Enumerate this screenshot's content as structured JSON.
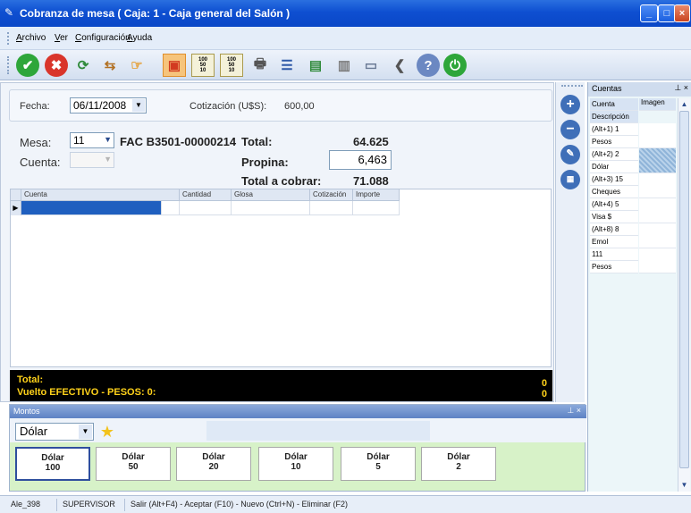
{
  "window": {
    "title": "Cobranza de mesa   ( Caja: 1 - Caja general del Salón )"
  },
  "menu": [
    "Archivo",
    "Ver",
    "Configuración",
    "Ayuda"
  ],
  "toolbar": {
    "calc_100_50_10_a": [
      "100",
      "50",
      "10"
    ],
    "calc_100_50_10_b": [
      "100",
      "50",
      "10"
    ]
  },
  "header": {
    "fecha_label": "Fecha:",
    "fecha_value": "06/11/2008",
    "cotizacion_label": "Cotización (U$S):",
    "cotizacion_value": "600,00"
  },
  "form": {
    "mesa_label": "Mesa:",
    "mesa_value": "11",
    "factura": "FAC B3501-00000214",
    "cuenta_label": "Cuenta:",
    "total_label": "Total:",
    "total_value": "64.625",
    "propina_label": "Propina:",
    "propina_value": "6,463",
    "total_cobrar_label": "Total a cobrar:",
    "total_cobrar_value": "71.088"
  },
  "grid": {
    "columns": [
      "Cuenta",
      "Cantidad",
      "Glosa",
      "Cotización",
      "Importe"
    ]
  },
  "totals_bar": {
    "total_label": "Total:",
    "total_value": "0",
    "vuelto_label": "Vuelto EFECTIVO - PESOS: 0:",
    "vuelto_value": "0"
  },
  "cuentas_panel": {
    "title": "Cuentas",
    "col_cuenta": "Cuenta",
    "col_imagen": "Imagen",
    "col_descripcion": "Descripción",
    "rows": [
      {
        "code": "(Alt+1) 1",
        "desc": "Pesos"
      },
      {
        "code": "(Alt+2) 2",
        "desc": "Dólar"
      },
      {
        "code": "(Alt+3) 15",
        "desc": "Cheques"
      },
      {
        "code": "(Alt+4) 5",
        "desc": "Visa $"
      },
      {
        "code": "(Alt+8) 8",
        "desc": "Emol"
      },
      {
        "code": "111",
        "desc": "Pesos"
      }
    ]
  },
  "montos_panel": {
    "title": "Montos",
    "currency": "Dólar",
    "buttons": [
      {
        "currency": "Dólar",
        "amount": "100"
      },
      {
        "currency": "Dólar",
        "amount": "50"
      },
      {
        "currency": "Dólar",
        "amount": "20"
      },
      {
        "currency": "Dólar",
        "amount": "10"
      },
      {
        "currency": "Dólar",
        "amount": "5"
      },
      {
        "currency": "Dólar",
        "amount": "2"
      }
    ]
  },
  "statusbar": {
    "host": "Ale_398",
    "user": "SUPERVISOR",
    "hints": "Salir (Alt+F4) - Aceptar (F10) - Nuevo (Ctrl+N) - Eliminar (F2)"
  },
  "colors": {
    "titlebar": "#0e4fd1",
    "accent_total": "#ffd21a",
    "montos_bg": "#d7f2c8"
  }
}
